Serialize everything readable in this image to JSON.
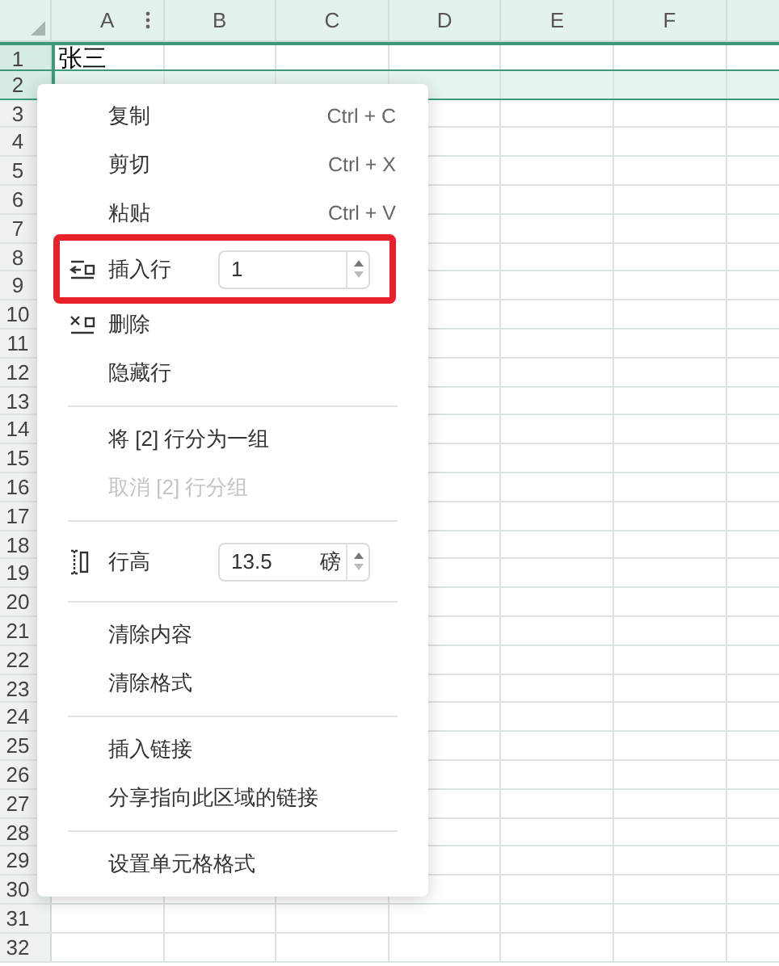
{
  "sheet": {
    "columns": [
      "A",
      "B",
      "C",
      "D",
      "E",
      "F"
    ],
    "rows": [
      {
        "label": "1",
        "selected": true,
        "active": true,
        "cells": [
          "张三"
        ]
      },
      {
        "label": "2",
        "selected": true,
        "active": false
      },
      {
        "label": "3",
        "selected": false
      },
      {
        "label": "4",
        "selected": false
      },
      {
        "label": "5",
        "selected": false
      },
      {
        "label": "6",
        "selected": false
      },
      {
        "label": "7",
        "selected": false
      },
      {
        "label": "8",
        "selected": false
      },
      {
        "label": "9",
        "selected": false
      },
      {
        "label": "10",
        "selected": false
      },
      {
        "label": "11",
        "selected": false
      },
      {
        "label": "12",
        "selected": false
      },
      {
        "label": "13",
        "selected": false
      },
      {
        "label": "14",
        "selected": false
      },
      {
        "label": "15",
        "selected": false
      },
      {
        "label": "16",
        "selected": false
      },
      {
        "label": "17",
        "selected": false
      },
      {
        "label": "18",
        "selected": false
      },
      {
        "label": "19",
        "selected": false
      },
      {
        "label": "20",
        "selected": false
      },
      {
        "label": "21",
        "selected": false
      },
      {
        "label": "22",
        "selected": false
      },
      {
        "label": "23",
        "selected": false
      },
      {
        "label": "24",
        "selected": false
      },
      {
        "label": "25",
        "selected": false
      },
      {
        "label": "26",
        "selected": false
      },
      {
        "label": "27",
        "selected": false
      },
      {
        "label": "28",
        "selected": false
      },
      {
        "label": "29",
        "selected": false
      },
      {
        "label": "30",
        "selected": false
      },
      {
        "label": "31",
        "selected": false
      },
      {
        "label": "32",
        "selected": false
      }
    ]
  },
  "context_menu": {
    "items": [
      {
        "kind": "command",
        "label": "复制",
        "shortcut": "Ctrl + C",
        "disabled": false
      },
      {
        "kind": "command",
        "label": "剪切",
        "shortcut": "Ctrl + X",
        "disabled": false
      },
      {
        "kind": "command",
        "label": "粘贴",
        "shortcut": "Ctrl + V",
        "disabled": false
      },
      {
        "kind": "stepper",
        "label": "插入行",
        "value": "1",
        "highlighted": true
      },
      {
        "kind": "command",
        "label": "删除",
        "disabled": false
      },
      {
        "kind": "command",
        "label": "隐藏行",
        "disabled": false
      },
      {
        "kind": "divider"
      },
      {
        "kind": "command",
        "label": "将 [2] 行分为一组",
        "disabled": false
      },
      {
        "kind": "command",
        "label": "取消 [2] 行分组",
        "disabled": true
      },
      {
        "kind": "divider"
      },
      {
        "kind": "stepper",
        "label": "行高",
        "value": "13.5",
        "unit": "磅",
        "highlighted": false
      },
      {
        "kind": "divider"
      },
      {
        "kind": "command",
        "label": "清除内容",
        "disabled": false
      },
      {
        "kind": "command",
        "label": "清除格式",
        "disabled": false
      },
      {
        "kind": "divider"
      },
      {
        "kind": "command",
        "label": "插入链接",
        "disabled": false
      },
      {
        "kind": "command",
        "label": "分享指向此区域的链接",
        "disabled": false
      },
      {
        "kind": "divider"
      },
      {
        "kind": "command",
        "label": "设置单元格格式",
        "disabled": false
      }
    ]
  }
}
